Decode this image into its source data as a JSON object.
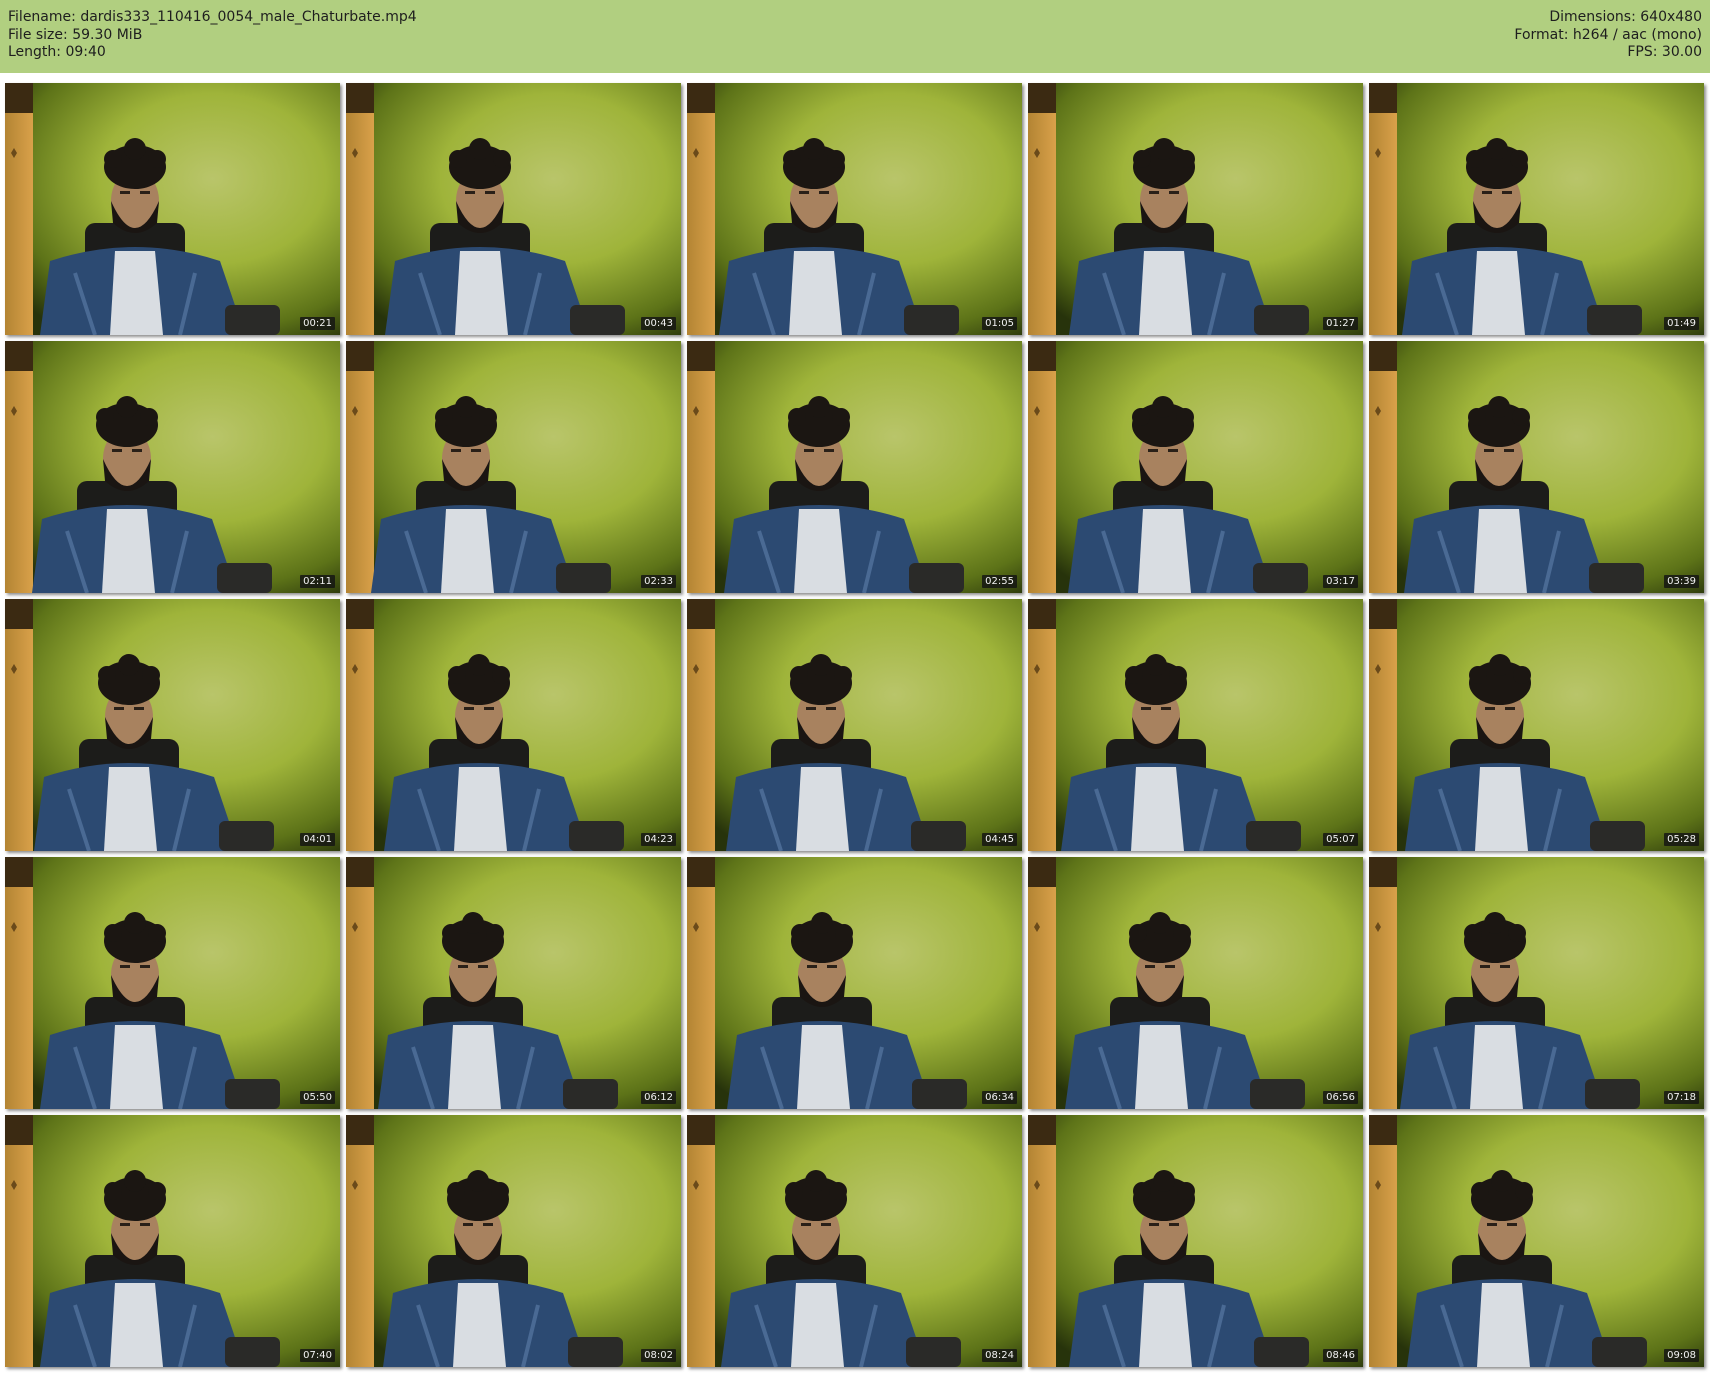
{
  "header": {
    "filename_label": "Filename:",
    "filename": "dardis333_110416_0054_male_Chaturbate.mp4",
    "filesize_label": "File size:",
    "filesize": "59.30 MiB",
    "length_label": "Length:",
    "length": "09:40",
    "dimensions_label": "Dimensions:",
    "dimensions": "640x480",
    "format_label": "Format:",
    "format": "h264 / aac (mono)",
    "fps_label": "FPS:",
    "fps": "30.00"
  },
  "colors": {
    "header_bg": "#b1cf80",
    "background_green": "#a6b83a",
    "jacket_denim": "#2c4a72"
  },
  "thumbnails": [
    {
      "timestamp": "00:21"
    },
    {
      "timestamp": "00:43"
    },
    {
      "timestamp": "01:05"
    },
    {
      "timestamp": "01:27"
    },
    {
      "timestamp": "01:49"
    },
    {
      "timestamp": "02:11"
    },
    {
      "timestamp": "02:33"
    },
    {
      "timestamp": "02:55"
    },
    {
      "timestamp": "03:17"
    },
    {
      "timestamp": "03:39"
    },
    {
      "timestamp": "04:01"
    },
    {
      "timestamp": "04:23"
    },
    {
      "timestamp": "04:45"
    },
    {
      "timestamp": "05:07"
    },
    {
      "timestamp": "05:28"
    },
    {
      "timestamp": "05:50"
    },
    {
      "timestamp": "06:12"
    },
    {
      "timestamp": "06:34"
    },
    {
      "timestamp": "06:56"
    },
    {
      "timestamp": "07:18"
    },
    {
      "timestamp": "07:40"
    },
    {
      "timestamp": "08:02"
    },
    {
      "timestamp": "08:24"
    },
    {
      "timestamp": "08:46"
    },
    {
      "timestamp": "09:08"
    }
  ]
}
